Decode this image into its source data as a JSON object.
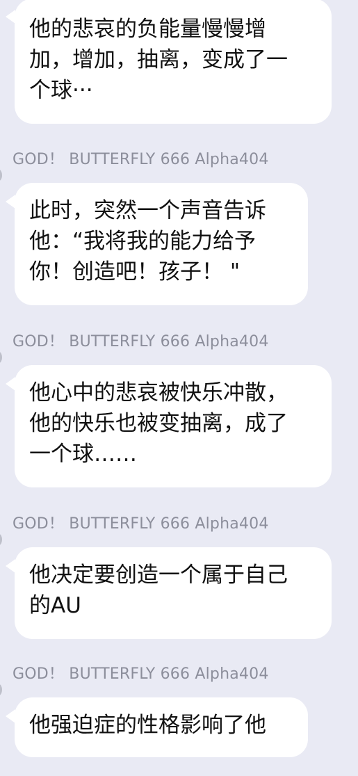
{
  "colors": {
    "background": "#e9eaf4",
    "bubble": "#ffffff",
    "sender_name": "#8c8e9b",
    "message_text": "#111111"
  },
  "messages": [
    {
      "sender": "",
      "lines": [
        "他的悲哀的负能量慢慢增",
        "加，增加，抽离，变成了一",
        "个球···"
      ]
    },
    {
      "sender": "GOD！ BUTTERFLY 666 Alpha404",
      "lines": [
        "此时，突然一个声音告诉",
        "他：“我将我的能力给予",
        "你！创造吧！孩子！ \""
      ]
    },
    {
      "sender": "GOD！ BUTTERFLY 666 Alpha404",
      "lines": [
        "他心中的悲哀被快乐冲散，",
        "他的快乐也被变抽离，成了",
        "一个球……"
      ]
    },
    {
      "sender": "GOD！ BUTTERFLY 666 Alpha404",
      "lines": [
        "他决定要创造一个属于自己",
        "的AU"
      ]
    },
    {
      "sender": "GOD！ BUTTERFLY 666 Alpha404",
      "lines": [
        "他强迫症的性格影响了他"
      ]
    }
  ]
}
